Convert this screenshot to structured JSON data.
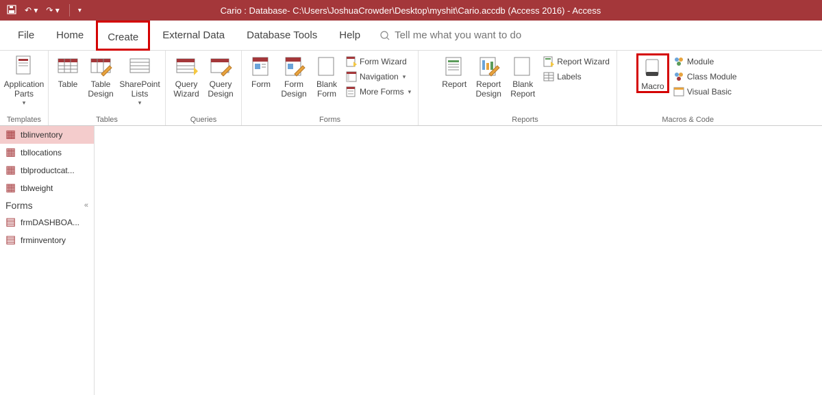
{
  "titlebar": {
    "text": "Cario : Database- C:\\Users\\JoshuaCrowder\\Desktop\\myshit\\Cario.accdb (Access 2016)  -  Access"
  },
  "tabs": {
    "file": "File",
    "home": "Home",
    "create": "Create",
    "external": "External Data",
    "dbtools": "Database Tools",
    "help": "Help"
  },
  "tellme": {
    "placeholder": "Tell me what you want to do"
  },
  "ribbon": {
    "templates": {
      "label": "Templates",
      "appparts": "Application\nParts"
    },
    "tables": {
      "label": "Tables",
      "table": "Table",
      "tabledesign": "Table\nDesign",
      "splists": "SharePoint\nLists"
    },
    "queries": {
      "label": "Queries",
      "qwizard": "Query\nWizard",
      "qdesign": "Query\nDesign"
    },
    "forms": {
      "label": "Forms",
      "form": "Form",
      "formdesign": "Form\nDesign",
      "blankform": "Blank\nForm",
      "formwizard": "Form Wizard",
      "navigation": "Navigation",
      "moreforms": "More Forms"
    },
    "reports": {
      "label": "Reports",
      "report": "Report",
      "reportdesign": "Report\nDesign",
      "blankreport": "Blank\nReport",
      "reportwizard": "Report Wizard",
      "labels": "Labels"
    },
    "macros": {
      "label": "Macros & Code",
      "macro": "Macro",
      "module": "Module",
      "classmodule": "Class Module",
      "vb": "Visual Basic"
    }
  },
  "nav": {
    "forms_header": "Forms",
    "items_tables": [
      "tblinventory",
      "tbllocations",
      "tblproductcat...",
      "tblweight"
    ],
    "items_forms": [
      "frmDASHBOA...",
      "frminventory"
    ]
  }
}
